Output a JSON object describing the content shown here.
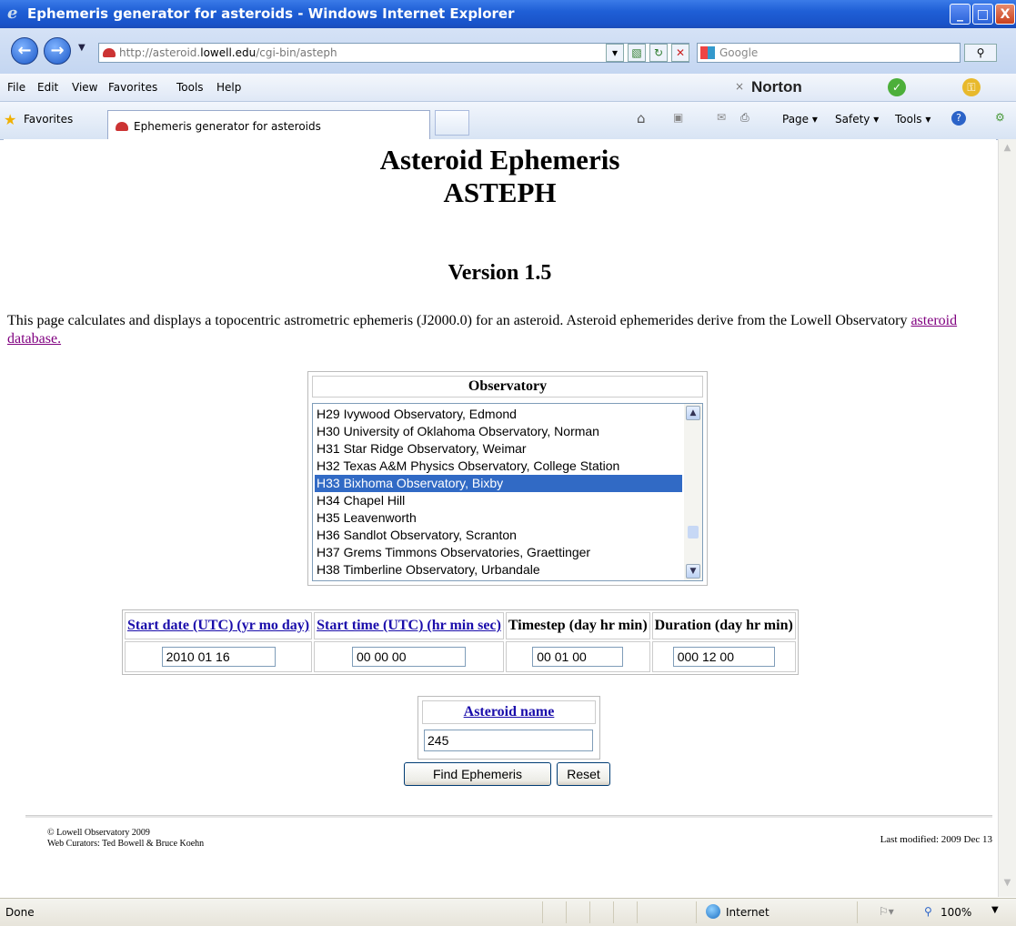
{
  "window": {
    "title": "Ephemeris generator for asteroids - Windows Internet Explorer",
    "minimize": "_",
    "maximize": "□",
    "close": "X"
  },
  "address_bar": {
    "url_prefix": "http://asteroid.",
    "url_domain": "lowell.edu",
    "url_suffix": "/cgi-bin/asteph",
    "search_placeholder": "Google"
  },
  "menu": {
    "items": [
      "File",
      "Edit",
      "View",
      "Favorites",
      "Tools",
      "Help"
    ],
    "norton_label": "Norton"
  },
  "favorites_bar": {
    "favorites_label": "Favorites",
    "tab_title": "Ephemeris generator for asteroids",
    "commands": [
      "Page ▾",
      "Safety ▾",
      "Tools ▾"
    ]
  },
  "page": {
    "title_line1": "Asteroid Ephemeris",
    "title_line2": "ASTEPH",
    "version": "Version 1.5",
    "intro_text": "This page calculates and displays a topocentric astrometric ephemeris (J2000.0) for an asteroid. Asteroid ephemerides derive from the Lowell Observatory ",
    "intro_link": "asteroid database."
  },
  "observatory": {
    "header": "Observatory",
    "options": [
      "H29 Ivywood Observatory, Edmond",
      "H30 University of Oklahoma Observatory, Norman",
      "H31 Star Ridge Observatory, Weimar",
      "H32 Texas A&M Physics Observatory, College Station",
      "H33 Bixhoma Observatory, Bixby",
      "H34 Chapel Hill",
      "H35 Leavenworth",
      "H36 Sandlot Observatory, Scranton",
      "H37 Grems Timmons Observatories, Graettinger",
      "H38 Timberline Observatory, Urbandale"
    ],
    "selected": "H33 Bixhoma Observatory, Bixby"
  },
  "time_table": {
    "headers": [
      "Start date (UTC) (yr mo day)",
      "Start time (UTC) (hr min sec)",
      "Timestep (day hr min)",
      "Duration (day hr min)"
    ],
    "values": [
      "2010 01 16",
      "00 00 00",
      "00 01 00",
      "000 12 00"
    ]
  },
  "asteroid": {
    "header": "Asteroid name",
    "value": "245"
  },
  "buttons": {
    "find": "Find Ephemeris",
    "reset": "Reset"
  },
  "footer": {
    "copyright": "© Lowell Observatory 2009",
    "curators": "Web Curators: Ted Bowell & Bruce Koehn",
    "modified": "Last modified: 2009 Dec 13"
  },
  "status_bar": {
    "status": "Done",
    "zone": "Internet",
    "zoom": "100%"
  },
  "colors": {
    "selection": "#316ac5",
    "link": "#1a0dab",
    "visited_link": "#800080",
    "titlebar": "#1f5fd6"
  }
}
